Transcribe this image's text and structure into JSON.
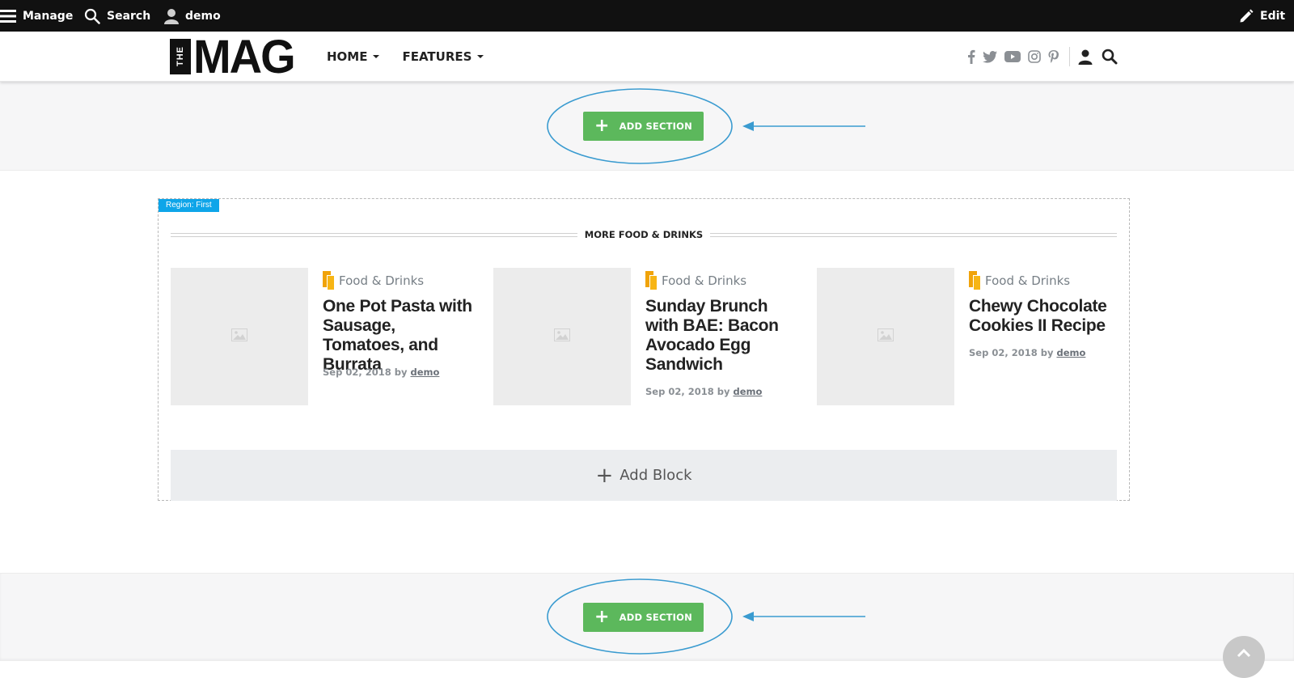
{
  "toolbar": {
    "manage_label": "Manage",
    "search_label": "Search",
    "user_label": "demo",
    "edit_label": "Edit"
  },
  "header": {
    "logo_small": "THE",
    "logo_large": "MAG",
    "nav": [
      {
        "label": "HOME"
      },
      {
        "label": "FEATURES"
      }
    ],
    "social_icons": [
      "facebook-icon",
      "twitter-icon",
      "youtube-icon",
      "instagram-icon",
      "pinterest-icon"
    ]
  },
  "sections": {
    "add_section_label": "ADD SECTION"
  },
  "region": {
    "label": "Region: First",
    "block_title": "MORE FOOD & DRINKS",
    "articles": [
      {
        "category": "Food & Drinks",
        "title": "One Pot Pasta with Sausage, Tomatoes, and Burrata",
        "date": "Sep 02, 2018",
        "by": "by",
        "author": "demo"
      },
      {
        "category": "Food & Drinks",
        "title": "Sunday Brunch with BAE: Bacon Avocado Egg Sandwich",
        "date": "Sep 02, 2018",
        "by": "by",
        "author": "demo"
      },
      {
        "category": "Food & Drinks",
        "title": "Chewy Chocolate Cookies II Recipe",
        "date": "Sep 02, 2018",
        "by": "by",
        "author": "demo"
      }
    ],
    "add_block_label": "Add Block"
  },
  "colors": {
    "toolbar_bg": "#111111",
    "add_section_green": "#5cb85c",
    "annotation_blue": "#3a9bd0",
    "region_label_blue": "#0ea5e9",
    "category_orange": "#f0a30a"
  }
}
